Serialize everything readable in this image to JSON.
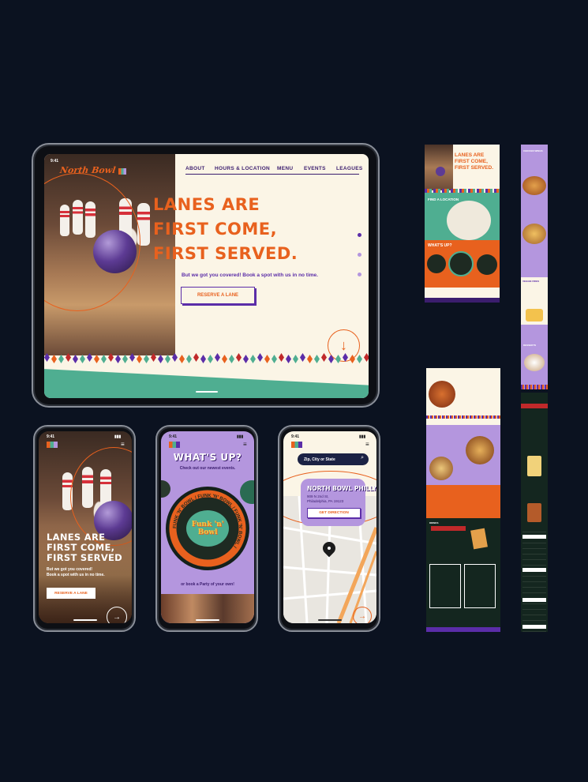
{
  "colors": {
    "background": "#0b1220",
    "cream": "#fbf5e6",
    "orange": "#e8611e",
    "purple": "#5b2da8",
    "lavender": "#b496de",
    "teal": "#4fae91",
    "dark_green": "#14261f"
  },
  "tablet": {
    "time": "9:41",
    "brand": "North Bowl",
    "nav": [
      "ABOUT",
      "HOURS & LOCATION",
      "MENU",
      "EVENTS",
      "LEAGUES"
    ],
    "headline": [
      "LANES ARE",
      "FIRST COME,",
      "FIRST SERVED."
    ],
    "subtext": "But we got you covered! Book a spot with us in no time.",
    "cta": "RESERVE A LANE"
  },
  "phone1": {
    "time": "9:41",
    "headline": [
      "LANES ARE",
      "FIRST COME,",
      "FIRST SERVED"
    ],
    "subtext": [
      "But we got you covered!",
      "Book a spot with us in no time."
    ],
    "cta": "RESERVE A LANE"
  },
  "phone2": {
    "time": "9:41",
    "title": "WHAT'S UP?",
    "subtitle": "Check out our newest events.",
    "event_ring": "FUNK 'N' BOWL / FUNK 'N' BOWL / FUNK 'N' BOWL /",
    "event_logo": [
      "Funk 'n'",
      "Bowl"
    ],
    "party": "or book a Party of your own!"
  },
  "phone3": {
    "time": "9:41",
    "search_placeholder": "Zip, City or State",
    "location_name": "NORTH BOWL PHILLY",
    "address": [
      "909 N 2nd St,",
      "Philadelphia, PA 19123"
    ],
    "direction_btn": "GET DIRECTION"
  },
  "thumbnails": {
    "hero_headline": [
      "LANES ARE",
      "FIRST COME,",
      "FIRST SERVED."
    ],
    "find_location": "FIND A LOCATION",
    "whats_up": "WHAT'S UP?",
    "chicken_wings": "CHICKEN WINGS",
    "veggie_fries": "VEGGIE FRIES",
    "desserts": "DESSERTS",
    "drinks": "DRINKS"
  }
}
